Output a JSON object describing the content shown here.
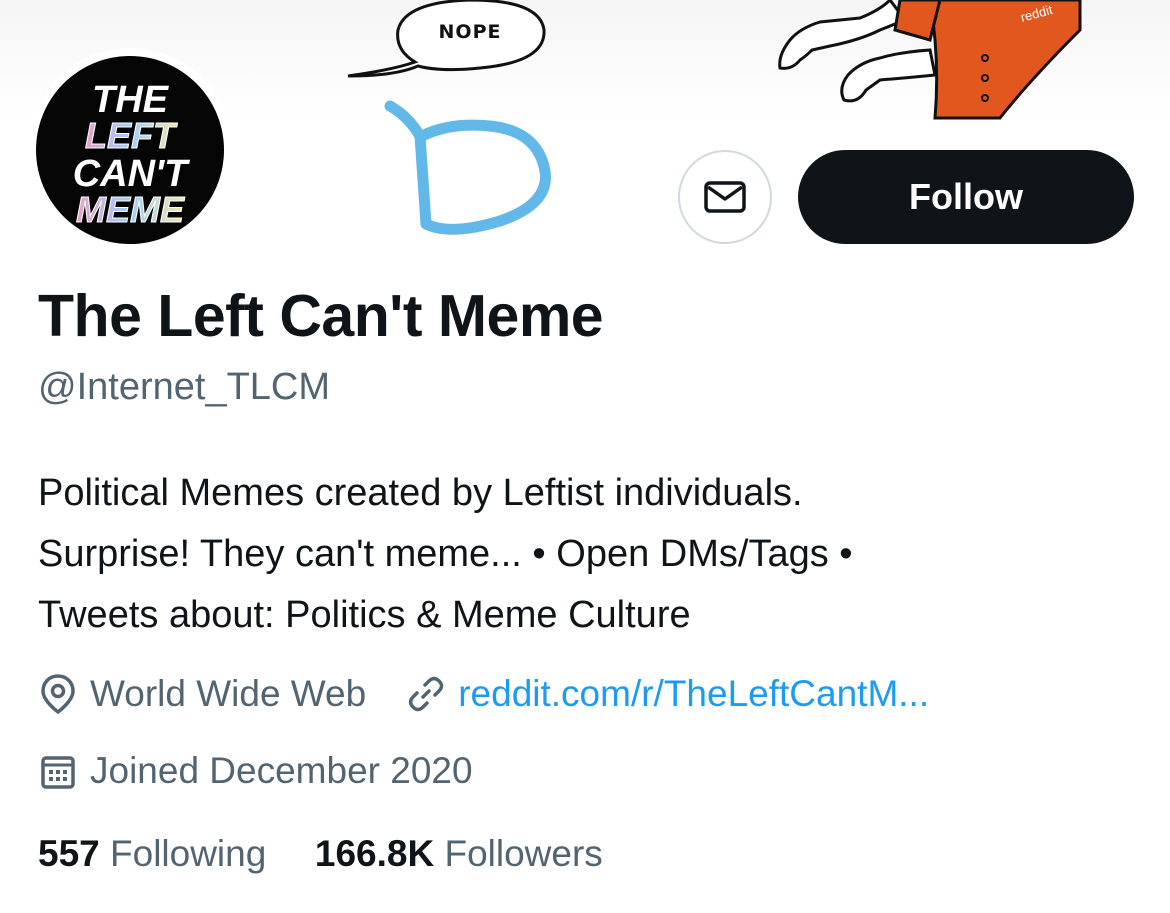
{
  "banner": {
    "speech_bubble_text": "NOPE",
    "sleeve_text": "reddit"
  },
  "avatar": {
    "lines": [
      "THE",
      "LEFT",
      "CAN'T",
      "MEME"
    ]
  },
  "actions": {
    "message_icon": "envelope-icon",
    "follow_label": "Follow"
  },
  "profile": {
    "name": "The Left Can't Meme",
    "handle": "@Internet_TLCM",
    "bio_lines": [
      "Political Memes created by Leftist individuals.",
      "Surprise! They can't meme... • Open DMs/Tags •",
      "Tweets about: Politics & Meme Culture"
    ],
    "location": "World Wide Web",
    "location_icon": "map-pin-icon",
    "website": "reddit.com/r/TheLeftCantM...",
    "website_icon": "link-icon",
    "joined": "Joined December 2020",
    "joined_icon": "calendar-icon"
  },
  "stats": {
    "following_count": "557",
    "following_label": "Following",
    "followers_count": "166.8K",
    "followers_label": "Followers"
  },
  "colors": {
    "text": "#0f1419",
    "secondary": "#536471",
    "link": "#1d9bf0",
    "button": "#0f1419",
    "sleeve": "#e2571e"
  }
}
